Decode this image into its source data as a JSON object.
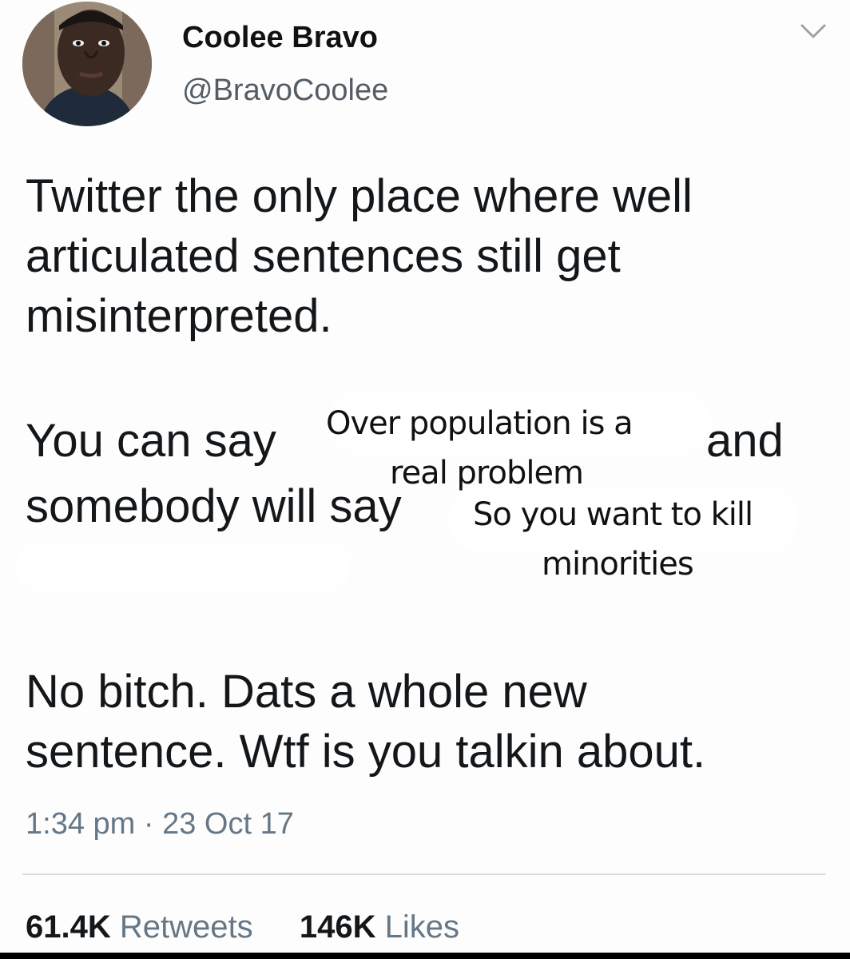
{
  "author": {
    "display_name": "Coolee Bravo",
    "handle": "@BravoCoolee"
  },
  "tweet": {
    "paragraph1": [
      "Twitter the only place where well",
      "articulated sentences still get",
      "misinterpreted."
    ],
    "paragraph2_fragments": {
      "you_can_say": "You can say",
      "and": "and",
      "somebody_will_say": "somebody will say"
    },
    "overlay_text": {
      "line1": "Over population is a",
      "line2": "real problem",
      "line3": "So you want to kill",
      "line4": "minorities"
    },
    "paragraph3": [
      "No bitch. Dats a whole new",
      "sentence. Wtf is you talkin about."
    ],
    "timestamp": "1:34 pm · 23 Oct 17"
  },
  "stats": {
    "retweets_count": "61.4K",
    "retweets_label": "Retweets",
    "likes_count": "146K",
    "likes_label": "Likes"
  },
  "icons": {
    "menu": "chevron-down-icon"
  }
}
